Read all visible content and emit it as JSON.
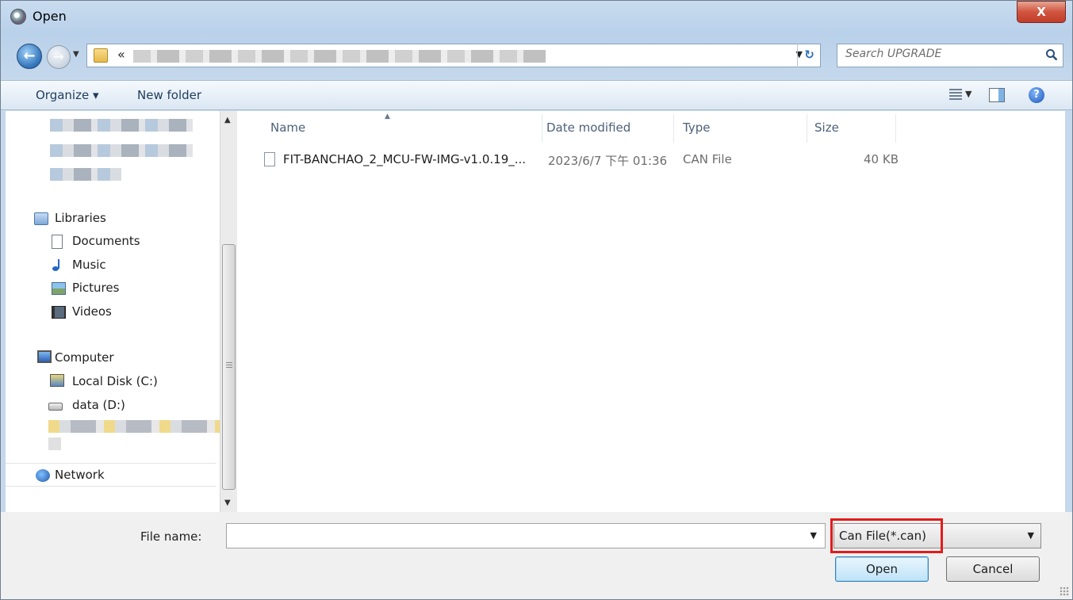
{
  "window": {
    "title": "Open",
    "close_label": "X"
  },
  "address": {
    "chevron": "«",
    "search_placeholder": "Search UPGRADE"
  },
  "toolbar": {
    "organize": "Organize ▾",
    "new_folder": "New folder"
  },
  "nav": {
    "libraries": "Libraries",
    "documents": "Documents",
    "music": "Music",
    "pictures": "Pictures",
    "videos": "Videos",
    "computer": "Computer",
    "local_disk": "Local Disk (C:)",
    "data_drive": "data (D:)",
    "network": "Network"
  },
  "columns": {
    "name": "Name",
    "date": "Date modified",
    "type": "Type",
    "size": "Size"
  },
  "files": [
    {
      "name": "FIT-BANCHAO_2_MCU-FW-IMG-v1.0.19_...",
      "date": "2023/6/7 下午 01:36",
      "type": "CAN File",
      "size": "40 KB"
    }
  ],
  "bottom": {
    "file_name_label": "File name:",
    "file_name_value": "",
    "filter": "Can File(*.can)",
    "open_label": "Open",
    "cancel_label": "Cancel"
  },
  "colors": {
    "highlight": "#e21b1b",
    "accent": "#3c7fb1"
  }
}
